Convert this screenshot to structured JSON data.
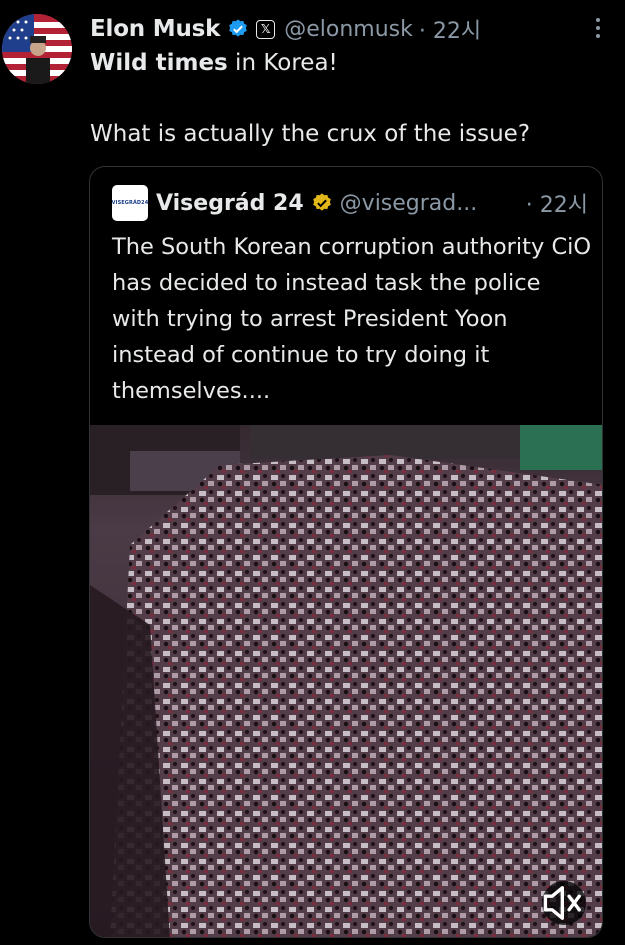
{
  "post": {
    "author_name": "Elon Musk",
    "handle": "@elonmusk",
    "time": "· 22시",
    "text_bold": "Wild times",
    "text_rest": " in Korea!",
    "text_line2": "What is actually the crux of the issue?"
  },
  "quoted": {
    "logo_text": "VISEGRÁD24",
    "author_name": "Visegrád 24",
    "handle": "@visegrad...",
    "time": "· 22시",
    "text": "The South Korean corruption authority CiO has decided to instead task the police with trying to arrest President Yoon instead of continue to try doing it themselves...."
  },
  "colors": {
    "verified_blue": "#1d9bf0",
    "verified_gold": "#e2b719",
    "muted_text": "#8b98a5"
  },
  "icons": [
    "verified-badge-icon",
    "x-affiliate-icon",
    "more-icon",
    "gold-verified-badge-icon",
    "volume-muted-icon"
  ]
}
